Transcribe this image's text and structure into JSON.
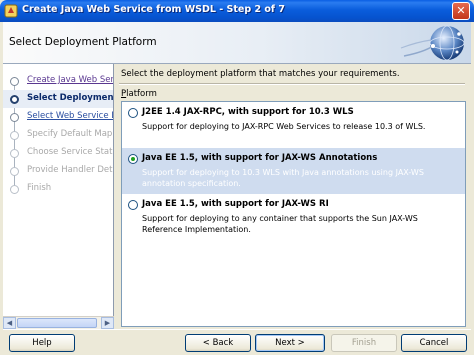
{
  "window": {
    "title": "Create Java Web Service from WSDL - Step 2 of 7",
    "close_glyph": "✕"
  },
  "header": {
    "title": "Select Deployment Platform"
  },
  "nav": {
    "items": [
      {
        "label": "Create Java Web Service",
        "state": "visited"
      },
      {
        "label": "Select Deployment Platform",
        "state": "current"
      },
      {
        "label": "Select Web Service Description",
        "state": "visited"
      },
      {
        "label": "Specify Default Mapping Options",
        "state": "disabled"
      },
      {
        "label": "Choose Service State",
        "state": "disabled"
      },
      {
        "label": "Provide Handler Details",
        "state": "disabled"
      },
      {
        "label": "Finish",
        "state": "disabled"
      }
    ],
    "scroll_left": "◀",
    "scroll_right": "▶"
  },
  "main": {
    "instruction": "Select the deployment platform that matches your requirements.",
    "platform_label_accel": "P",
    "platform_label_rest": "latform",
    "options": [
      {
        "title": "J2EE 1.4 JAX-RPC, with support for 10.3 WLS",
        "description": "Support for deploying to JAX-RPC Web Services to release 10.3 of WLS.",
        "selected": false
      },
      {
        "title": "Java EE 1.5, with support for JAX-WS Annotations",
        "description": "Support for deploying to 10.3 WLS with Java annotations using JAX-WS annotation specification.",
        "selected": true
      },
      {
        "title": "Java EE 1.5, with support for JAX-WS RI",
        "description": "Support for deploying to any container that supports the Sun JAX-WS Reference Implementation.",
        "selected": false
      }
    ]
  },
  "buttons": {
    "help": "Help",
    "back": "< Back",
    "next": "Next >",
    "finish": "Finish",
    "cancel": "Cancel"
  },
  "colors": {
    "titlebar": "#0a5ddc",
    "selected_row": "#cfdcef",
    "current_step": "#0b2a6a"
  }
}
